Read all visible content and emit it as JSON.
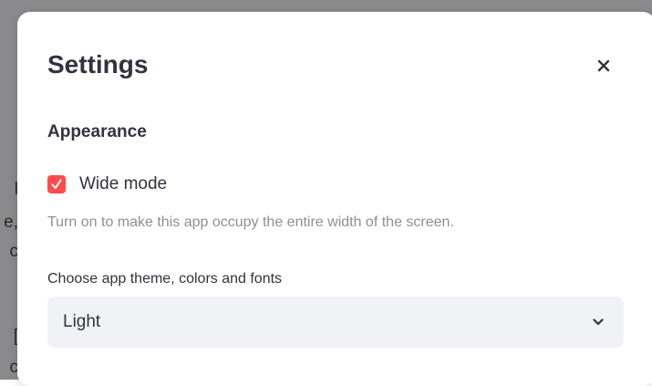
{
  "background": {
    "fragments": [
      "l",
      "e,",
      "c",
      "[",
      "c"
    ]
  },
  "modal": {
    "title": "Settings",
    "close_icon": "close-icon",
    "section_heading": "Appearance",
    "wide_mode": {
      "label": "Wide mode",
      "checked": true,
      "help": "Turn on to make this app occupy the entire width of the screen."
    },
    "theme": {
      "label": "Choose app theme, colors and fonts",
      "selected": "Light",
      "chevron_icon": "chevron-down-icon"
    }
  },
  "colors": {
    "accent": "#ff4b4b",
    "text": "#31333f",
    "muted": "#8d8f98",
    "select_bg": "#f0f2f6",
    "backdrop": "#8a8a8c"
  }
}
